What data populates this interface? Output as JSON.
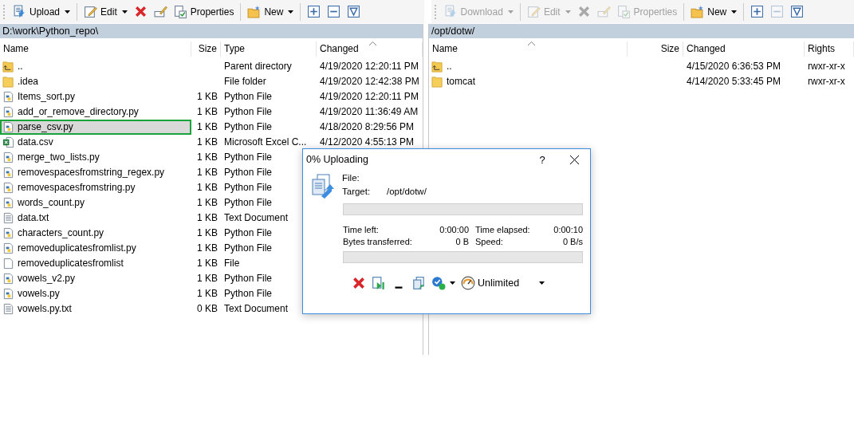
{
  "left_panel": {
    "toolbar": [
      {
        "kind": "upload",
        "label": "Upload",
        "dropdown": true,
        "disabled": false
      },
      {
        "kind": "edit",
        "label": "Edit",
        "dropdown": true,
        "disabled": false
      },
      {
        "kind": "delete",
        "disabled": false
      },
      {
        "kind": "rename",
        "disabled": false
      },
      {
        "kind": "properties",
        "label": "Properties",
        "disabled": false
      },
      {
        "kind": "new",
        "label": "New",
        "dropdown": true,
        "disabled": false
      },
      {
        "kind": "plus",
        "disabled": false
      },
      {
        "kind": "minus",
        "disabled": false
      },
      {
        "kind": "filter",
        "disabled": false
      }
    ],
    "path": "D:\\work\\Python_repo\\",
    "columns": [
      {
        "label": "Name",
        "sorted": false
      },
      {
        "label": "Size",
        "sorted": false
      },
      {
        "label": "Type",
        "sorted": false
      },
      {
        "label": "Changed",
        "sorted": true
      }
    ],
    "rows": [
      {
        "kind": "parent",
        "name": "..",
        "type": "Parent directory",
        "changed": "4/19/2020 12:20:11 PM",
        "selected": false
      },
      {
        "kind": "folder",
        "name": ".idea",
        "type": "File folder",
        "changed": "4/19/2020 12:42:38 PM",
        "selected": false
      },
      {
        "kind": "python",
        "name": "Items_sort.py",
        "size": "1 KB",
        "type": "Python File",
        "changed": "4/19/2020 12:20:11 PM",
        "selected": false
      },
      {
        "kind": "python",
        "name": "add_or_remove_directory.py",
        "size": "1 KB",
        "type": "Python File",
        "changed": "4/19/2020 11:36:49 AM",
        "selected": false
      },
      {
        "kind": "python",
        "name": "parse_csv.py",
        "size": "1 KB",
        "type": "Python File",
        "changed": "4/18/2020 8:29:56 PM",
        "selected": true
      },
      {
        "kind": "excel",
        "name": "data.csv",
        "size": "1 KB",
        "type": "Microsoft Excel C...",
        "changed": "4/12/2020 4:55:13 PM",
        "selected": false
      },
      {
        "kind": "python",
        "name": "merge_two_lists.py",
        "size": "1 KB",
        "type": "Python File",
        "selected": false
      },
      {
        "kind": "python",
        "name": "removespacesfromstring_regex.py",
        "size": "1 KB",
        "type": "Python File",
        "selected": false
      },
      {
        "kind": "python",
        "name": "removespacesfromstring.py",
        "size": "1 KB",
        "type": "Python File",
        "selected": false
      },
      {
        "kind": "python",
        "name": "words_count.py",
        "size": "1 KB",
        "type": "Python File",
        "selected": false
      },
      {
        "kind": "text",
        "name": "data.txt",
        "size": "1 KB",
        "type": "Text Document",
        "selected": false
      },
      {
        "kind": "python",
        "name": "characters_count.py",
        "size": "1 KB",
        "type": "Python File",
        "selected": false
      },
      {
        "kind": "python",
        "name": "removeduplicatesfromlist.py",
        "size": "1 KB",
        "type": "Python File",
        "selected": false
      },
      {
        "kind": "file",
        "name": "removeduplicatesfromlist",
        "size": "1 KB",
        "type": "File",
        "selected": false
      },
      {
        "kind": "python",
        "name": "vowels_v2.py",
        "size": "1 KB",
        "type": "Python File",
        "selected": false
      },
      {
        "kind": "python",
        "name": "vowels.py",
        "size": "1 KB",
        "type": "Python File",
        "selected": false
      },
      {
        "kind": "text",
        "name": "vowels.py.txt",
        "size": "0 KB",
        "type": "Text Document",
        "selected": false
      }
    ]
  },
  "right_panel": {
    "toolbar": [
      {
        "kind": "download",
        "label": "Download",
        "dropdown": true,
        "disabled": true
      },
      {
        "kind": "edit",
        "label": "Edit",
        "dropdown": true,
        "disabled": true
      },
      {
        "kind": "delete",
        "disabled": true
      },
      {
        "kind": "rename",
        "disabled": true
      },
      {
        "kind": "properties",
        "label": "Properties",
        "disabled": true
      },
      {
        "kind": "new",
        "label": "New",
        "dropdown": true,
        "disabled": false
      },
      {
        "kind": "plus",
        "disabled": false
      },
      {
        "kind": "minus",
        "disabled": true
      },
      {
        "kind": "filter",
        "disabled": false
      }
    ],
    "path": "/opt/dotw/",
    "columns": [
      {
        "label": "Name",
        "sorted": true
      },
      {
        "label": "Size",
        "sorted": false
      },
      {
        "label": "Changed",
        "sorted": false
      },
      {
        "label": "Rights",
        "sorted": false
      }
    ],
    "rows": [
      {
        "kind": "parent",
        "name": "..",
        "changed": "4/15/2020 6:36:53 PM",
        "rights": "rwxr-xr-x",
        "selected": false
      },
      {
        "kind": "folder",
        "name": "tomcat",
        "changed": "4/14/2020 5:33:45 PM",
        "rights": "rwxr-xr-x",
        "selected": false
      }
    ]
  },
  "dialog": {
    "title": "0% Uploading",
    "help": "?",
    "file_label": "File:",
    "target_label": "Target:",
    "target": "/opt/dotw/",
    "file_progress": {
      "level": 0
    },
    "stats": [
      {
        "label": "Time left:",
        "value": "0:00:00"
      },
      {
        "label": "Time elapsed:",
        "value": "0:00:10"
      },
      {
        "label": "Bytes transferred:",
        "value": "0 B"
      },
      {
        "label": "Speed:",
        "value": "0 B/s"
      }
    ],
    "total_progress": {
      "level": 0
    },
    "speed_limit": "Unlimited"
  }
}
